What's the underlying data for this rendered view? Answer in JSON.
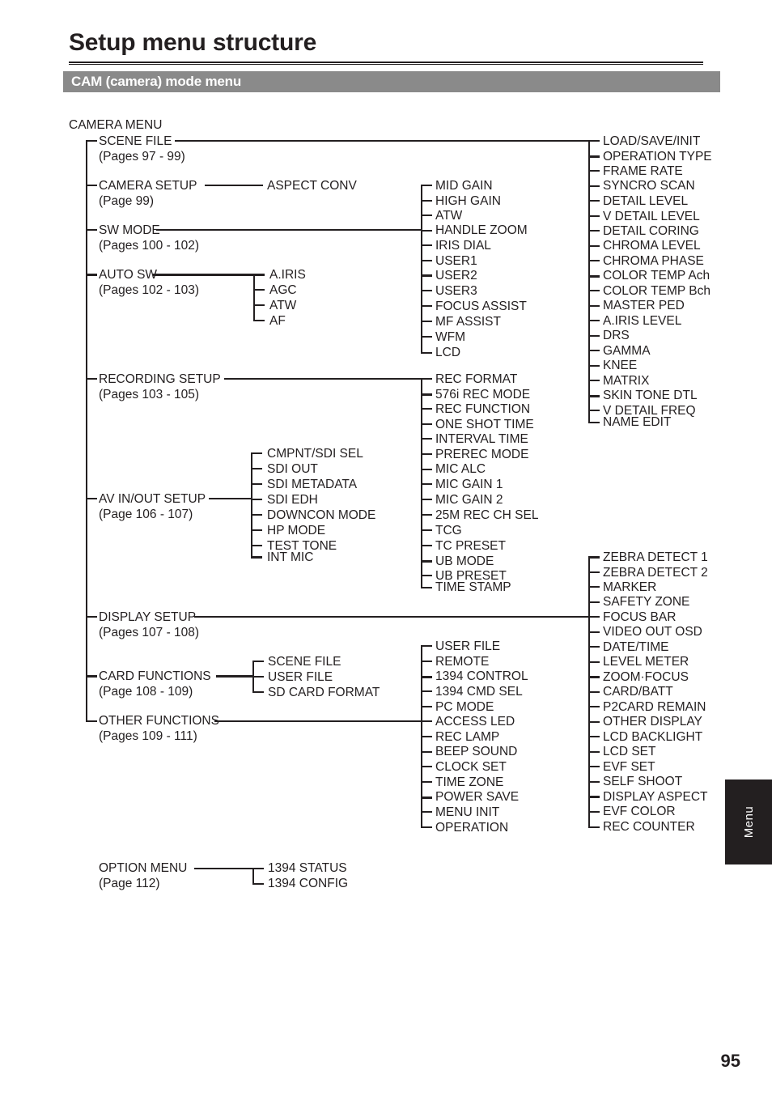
{
  "page": {
    "title": "Setup menu structure",
    "section_label": "CAM (camera) mode menu",
    "number": "95",
    "side_tab_label": "Menu"
  },
  "root": {
    "label": "CAMERA MENU"
  },
  "colors": {
    "ink": "#231f20",
    "section_bar": "#8a8a8a",
    "side_tab": "#231f20",
    "page_background": "#ffffff"
  },
  "menus": [
    {
      "label": "SCENE FILE",
      "pages": "(Pages 97 - 99)"
    },
    {
      "label": "CAMERA SETUP",
      "pages": "(Page 99)"
    },
    {
      "label": "SW MODE",
      "pages": "(Pages 100 - 102)"
    },
    {
      "label": "AUTO SW",
      "pages": "(Pages 102 - 103)"
    },
    {
      "label": "RECORDING SETUP",
      "pages": "(Pages 103 - 105)"
    },
    {
      "label": "AV IN/OUT SETUP",
      "pages": "(Page 106 - 107)"
    },
    {
      "label": "DISPLAY SETUP",
      "pages": "(Pages 107 - 108)"
    },
    {
      "label": "CARD FUNCTIONS",
      "pages": "(Page 108 - 109)"
    },
    {
      "label": "OTHER FUNCTIONS",
      "pages": "(Pages 109 - 111)"
    }
  ],
  "option_menu": {
    "label": "OPTION MENU",
    "pages": "(Page 112)"
  },
  "option_menu_items": [
    "1394 STATUS",
    "1394 CONFIG"
  ],
  "camera_setup_items": [
    "ASPECT CONV"
  ],
  "auto_sw_items": [
    "A.IRIS",
    "AGC",
    "ATW",
    "AF"
  ],
  "sw_mode_items": [
    "MID GAIN",
    "HIGH GAIN",
    "ATW",
    "HANDLE ZOOM",
    "IRIS DIAL",
    "USER1",
    "USER2",
    "USER3",
    "FOCUS ASSIST",
    "MF ASSIST",
    "WFM",
    "LCD"
  ],
  "scene_file_items": [
    "LOAD/SAVE/INIT",
    "OPERATION TYPE",
    "FRAME RATE",
    "SYNCRO SCAN",
    "DETAIL LEVEL",
    "V DETAIL LEVEL",
    "DETAIL CORING",
    "CHROMA LEVEL",
    "CHROMA PHASE",
    "COLOR TEMP Ach",
    "COLOR TEMP Bch",
    "MASTER PED",
    "A.IRIS LEVEL",
    "DRS",
    "GAMMA",
    "KNEE",
    "MATRIX",
    "SKIN TONE DTL",
    "V DETAIL FREQ",
    "NAME EDIT"
  ],
  "recording_setup_items": [
    "REC FORMAT",
    "576i REC MODE",
    "REC FUNCTION",
    "ONE SHOT TIME",
    "INTERVAL TIME",
    "PREREC MODE",
    "MIC ALC",
    "MIC GAIN 1",
    "MIC GAIN 2",
    "25M REC CH SEL",
    "TCG",
    "TC PRESET",
    "UB MODE",
    "UB PRESET",
    "TIME STAMP"
  ],
  "av_in_out_items": [
    "CMPNT/SDI SEL",
    "SDI OUT",
    "SDI METADATA",
    "SDI EDH",
    "DOWNCON MODE",
    "HP MODE",
    "TEST TONE",
    "INT MIC"
  ],
  "display_setup_items": [
    "ZEBRA DETECT 1",
    "ZEBRA DETECT 2",
    "MARKER",
    "SAFETY ZONE",
    "FOCUS BAR",
    "VIDEO OUT OSD",
    "DATE/TIME",
    "LEVEL METER",
    "ZOOM·FOCUS",
    "CARD/BATT",
    "P2CARD REMAIN",
    "OTHER DISPLAY",
    "LCD BACKLIGHT",
    "LCD SET",
    "EVF SET",
    "SELF SHOOT",
    "DISPLAY ASPECT",
    "EVF COLOR",
    "REC COUNTER"
  ],
  "card_functions_items": [
    "SCENE FILE",
    "USER FILE",
    "SD CARD FORMAT"
  ],
  "other_functions_items": [
    "USER FILE",
    "REMOTE",
    "1394 CONTROL",
    "1394 CMD SEL",
    "PC MODE",
    "ACCESS LED",
    "REC LAMP",
    "BEEP SOUND",
    "CLOCK SET",
    "TIME ZONE",
    "POWER SAVE",
    "MENU INIT",
    "OPERATION"
  ]
}
